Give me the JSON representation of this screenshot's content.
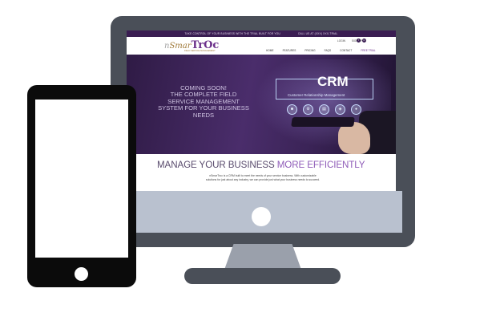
{
  "topbar": {
    "left": "TAKE CONTROL OF YOUR BUSINESS WITH THE TRIAL BUILT FOR YOU",
    "right": "CALL US AT (XXX) XXX-TRIAL"
  },
  "header": {
    "logo_n": "n",
    "logo_smar": "Smar",
    "logo_troc": "TrOc",
    "logo_tagline": "FIELD SERVICE MANAGEMENT",
    "login": "LOGIN",
    "signup": "SIGN UP",
    "social": [
      "f",
      "in"
    ],
    "nav": [
      "HOME",
      "FEATURES",
      "PRICING",
      "FAQS",
      "CONTACT",
      "FREE TRIAL"
    ]
  },
  "hero": {
    "line1": "COMING SOON!",
    "line2": "THE COMPLETE FIELD",
    "line3": "SERVICE MANAGEMENT",
    "line4": "SYSTEM FOR YOUR BUSINESS",
    "line5": "NEEDS",
    "crm_title": "CRM",
    "crm_sub": "Customer Relationship Management",
    "crm_icons": [
      "person-icon",
      "gear-icon",
      "cart-icon",
      "network-icon",
      "group-icon"
    ]
  },
  "content": {
    "headline_main": "MANAGE YOUR BUSINESS ",
    "headline_accent": "MORE EFFICIENTLY",
    "desc_line1": "nSmarTroc is a CRM built to meet the needs of your service business. With customizable",
    "desc_line2": "solutions for just about any industry, we can provide just what your business needs to succeed."
  },
  "colors": {
    "brand_purple": "#6b2f8a",
    "topbar": "#3a1d52",
    "monitor_frame": "#4a4f58",
    "monitor_chin": "#b9c1cf",
    "phone_body": "#0b0b0b"
  }
}
